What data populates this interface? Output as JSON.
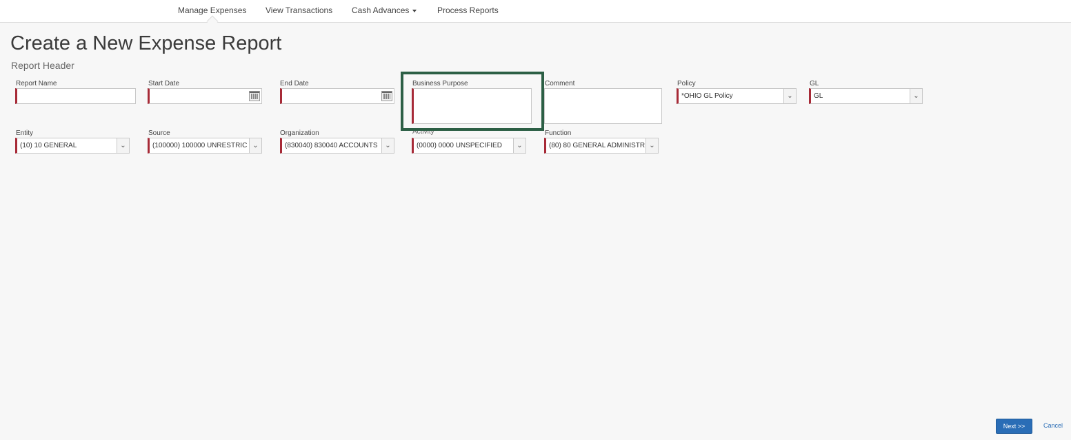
{
  "nav": {
    "items": [
      {
        "label": "Manage Expenses"
      },
      {
        "label": "View Transactions"
      },
      {
        "label": "Cash Advances"
      },
      {
        "label": "Process Reports"
      }
    ]
  },
  "page": {
    "title": "Create a New Expense Report",
    "section": "Report Header"
  },
  "fields": {
    "report_name": {
      "label": "Report Name",
      "value": ""
    },
    "start_date": {
      "label": "Start Date",
      "value": ""
    },
    "end_date": {
      "label": "End Date",
      "value": ""
    },
    "business_purpose": {
      "label": "Business Purpose",
      "value": ""
    },
    "comment": {
      "label": "Comment",
      "value": ""
    },
    "policy": {
      "label": "Policy",
      "value": "*OHIO GL Policy"
    },
    "gl": {
      "label": "GL",
      "value": "GL"
    },
    "entity": {
      "label": "Entity",
      "value": "(10) 10 GENERAL"
    },
    "source": {
      "label": "Source",
      "value": "(100000) 100000 UNRESTRIC"
    },
    "organization": {
      "label": "Organization",
      "value": "(830040) 830040 ACCOUNTS"
    },
    "activity": {
      "label": "Activity",
      "value": "(0000) 0000 UNSPECIFIED"
    },
    "function": {
      "label": "Function",
      "value": "(80) 80 GENERAL ADMINISTR"
    }
  },
  "actions": {
    "next": "Next >>",
    "cancel": "Cancel"
  },
  "colors": {
    "required_marker": "#a72a37",
    "highlight_border": "#2c5f45",
    "primary_button": "#2a6db6"
  }
}
